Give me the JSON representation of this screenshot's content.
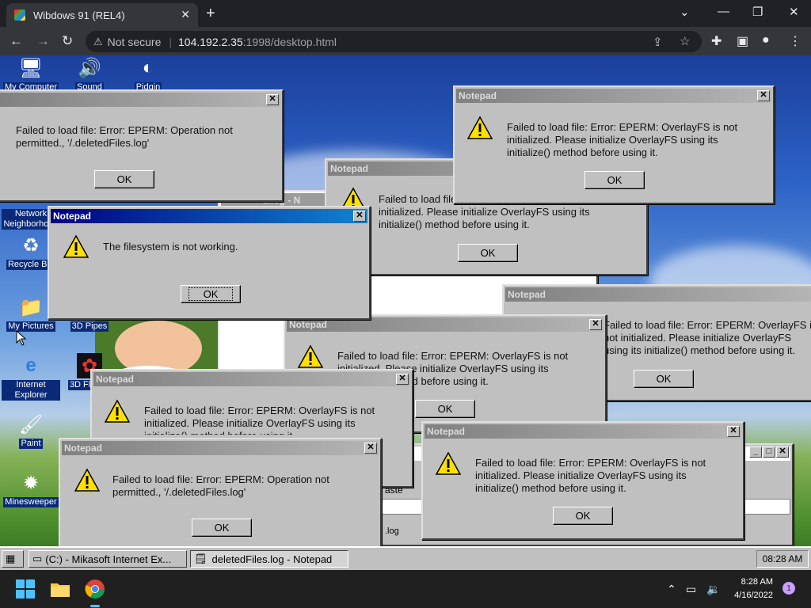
{
  "browser": {
    "tab_title": "Wibdows 91 (REL4)",
    "not_secure": "Not secure",
    "url_host": "104.192.2.35",
    "url_path": ":1998/desktop.html"
  },
  "desktop_icons": [
    {
      "label": "My Computer"
    },
    {
      "label": "Sound"
    },
    {
      "label": "Pidgin"
    },
    {
      "label": "Network Neighborhood"
    },
    {
      "label": "Recycle Bin"
    },
    {
      "label": "My Pictures"
    },
    {
      "label": "3D Pipes"
    },
    {
      "label": "Internet Explorer"
    },
    {
      "label": "3D Flower"
    },
    {
      "label": "Paint"
    },
    {
      "label": "Minesweeper"
    }
  ],
  "dialogs": {
    "title": "Notepad",
    "ok": "OK",
    "eperm_perm": "Failed to load file: Error: EPERM: Operation not permitted., '/.deletedFiles.log'",
    "eperm_overlay": "Failed to load file: Error: EPERM: OverlayFS is not initialized. Please initialize OverlayFS using its initialize() method before using it.",
    "fs_not_working": "The filesystem is not working."
  },
  "background_fragments": {
    "log_title": "s.log - N",
    "paste": "aste",
    "log": ".log"
  },
  "w98_taskbar": {
    "items": [
      {
        "label": "(C:) - Mikasoft Internet Ex..."
      },
      {
        "label": "deletedFiles.log - Notepad"
      }
    ],
    "clock": "08:28 AM"
  },
  "win11_taskbar": {
    "time": "8:28 AM",
    "date": "4/16/2022",
    "notification_count": "1"
  }
}
